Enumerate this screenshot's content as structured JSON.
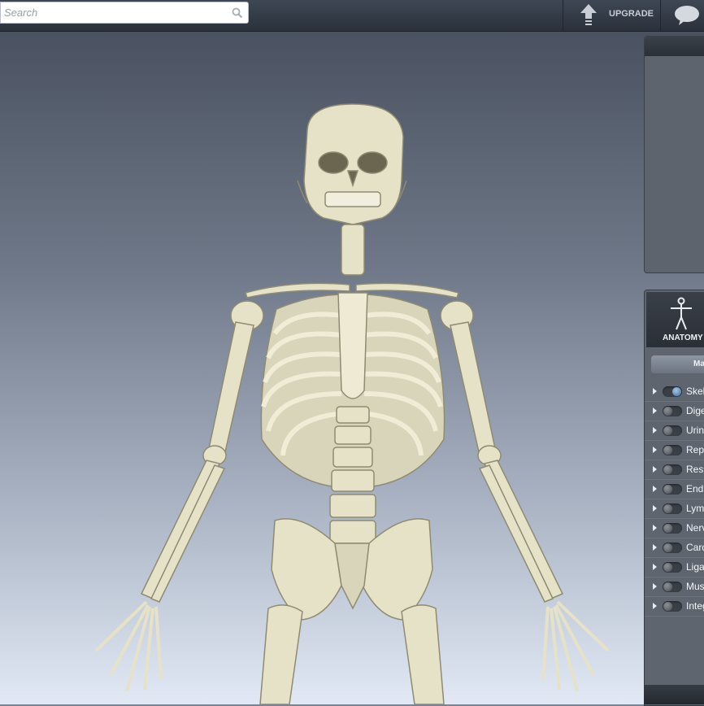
{
  "search": {
    "placeholder": "Search",
    "icon": "magnifier-icon"
  },
  "header": {
    "upgrade_label": "UPGRADE",
    "upgrade_icon": "upload-arrow-icon",
    "chat_icon": "speech-bubble-icon"
  },
  "panel": {
    "anatomy_tab_label": "ANATOMY",
    "anatomy_tab_icon": "vitruvian-figure-icon",
    "menu_button_label": "Ma",
    "systems": [
      {
        "label": "Skel",
        "on": true
      },
      {
        "label": "Dige",
        "on": false
      },
      {
        "label": "Urin",
        "on": false
      },
      {
        "label": "Rep",
        "on": false
      },
      {
        "label": "Res",
        "on": false
      },
      {
        "label": "End",
        "on": false
      },
      {
        "label": "Lym",
        "on": false
      },
      {
        "label": "Nerv",
        "on": false
      },
      {
        "label": "Card",
        "on": false
      },
      {
        "label": "Liga",
        "on": false
      },
      {
        "label": "Mus",
        "on": false
      },
      {
        "label": "Integ",
        "on": false
      }
    ]
  },
  "colors": {
    "bone": "#e8e4cc",
    "toggle_on": "#3e6c99",
    "topbar": "#2f3640"
  }
}
